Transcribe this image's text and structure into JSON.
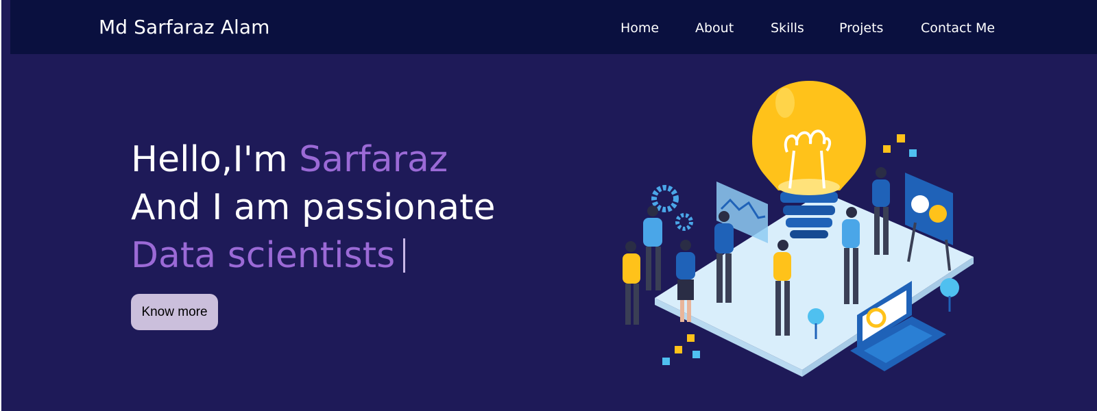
{
  "navbar": {
    "brand": "Md Sarfaraz Alam",
    "links": [
      {
        "label": "Home"
      },
      {
        "label": "About"
      },
      {
        "label": "Skills"
      },
      {
        "label": "Projets"
      },
      {
        "label": "Contact Me"
      }
    ]
  },
  "hero": {
    "greeting": "Hello,I'm ",
    "name": "Sarfaraz",
    "line2": "And I am passionate",
    "role": "Data scientists",
    "button_label": "Know more"
  },
  "illustration": {
    "icon": "idea-team-illustration"
  },
  "colors": {
    "background": "#1e1a58",
    "navbar": "#0a103f",
    "accent": "#9b6ad6",
    "button": "#cbbfdc",
    "bulb": "#ffc21a"
  }
}
